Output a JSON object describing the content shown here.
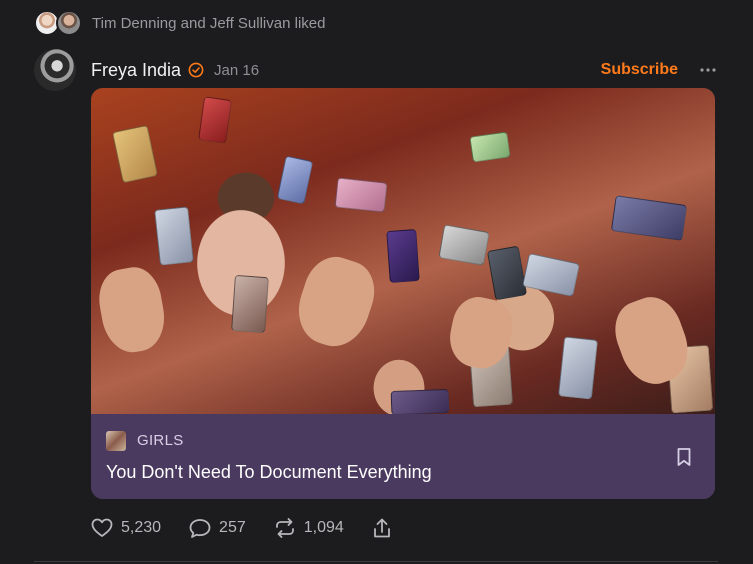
{
  "activity": {
    "liked_text": "Tim Denning and Jeff Sullivan liked"
  },
  "post": {
    "author": "Freya India",
    "date": "Jan 16",
    "subscribe_label": "Subscribe",
    "publication": "GIRLS",
    "title": "You Don't Need To Document Everything",
    "likes": "5,230",
    "comments": "257",
    "restacks": "1,094"
  },
  "colors": {
    "accent": "#ff7a1a",
    "card": "#4b3a5f",
    "background": "#1c1c1e"
  },
  "icons": {
    "verified": "verified-icon",
    "more": "more-icon",
    "bookmark": "bookmark-icon",
    "like": "heart-icon",
    "comment": "comment-icon",
    "restack": "restack-icon",
    "share": "share-icon"
  }
}
